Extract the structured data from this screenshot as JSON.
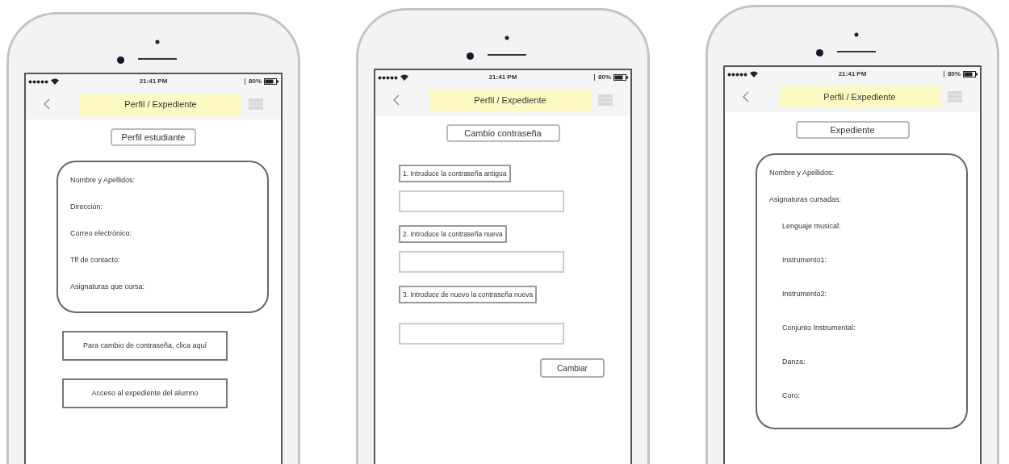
{
  "phones": [
    {
      "status_bar": {
        "time": "21:41 PM",
        "battery": "80%"
      },
      "nav": {
        "title": "Perfil / Expediente"
      },
      "heading": "Perfil estudiante",
      "content": [
        {
          "kind": "card",
          "lines": [
            {
              "text": "Nombre y Apellidos:"
            },
            {
              "text": "Dirección:"
            },
            {
              "text": "Correo electrónico:"
            },
            {
              "text": "Tlf de contacto:"
            },
            {
              "text": "Asignaturas que cursa:"
            }
          ]
        },
        {
          "kind": "link_button",
          "text": "Para cambio de contraseña, clica aquí"
        },
        {
          "kind": "link_button",
          "text": "Acceso al expediente del alumno"
        }
      ]
    },
    {
      "status_bar": {
        "time": "21:41 PM",
        "battery": "80%"
      },
      "nav": {
        "title": "Perfil / Expediente"
      },
      "heading": "Cambio contraseña",
      "content": [
        {
          "kind": "label",
          "text": "1. Introduce la contraseña antigua"
        },
        {
          "kind": "input"
        },
        {
          "kind": "label",
          "text": "2. Introduce la contraseña nueva"
        },
        {
          "kind": "input"
        },
        {
          "kind": "label",
          "text": "3. Introduce de nuevo la contraseña nueva"
        },
        {
          "kind": "input"
        },
        {
          "kind": "button",
          "text": "Cambiar"
        }
      ]
    },
    {
      "status_bar": {
        "time": "21:41 PM",
        "battery": "80%"
      },
      "nav": {
        "title": "Perfil / Expediente"
      },
      "heading": "Expediente",
      "content": [
        {
          "kind": "card",
          "lines": [
            {
              "text": "Nombre y Apellidos:"
            },
            {
              "text": "Asignaturas cursadas:",
              "children": [
                {
                  "text": "Lenguaje musical:"
                },
                {
                  "text": "Instrumento1:"
                },
                {
                  "text": "Instrumento2:"
                },
                {
                  "text": "Conjunto Instrumental:"
                },
                {
                  "text": "Danza:"
                },
                {
                  "text": "Coro:"
                }
              ]
            }
          ]
        }
      ]
    }
  ]
}
